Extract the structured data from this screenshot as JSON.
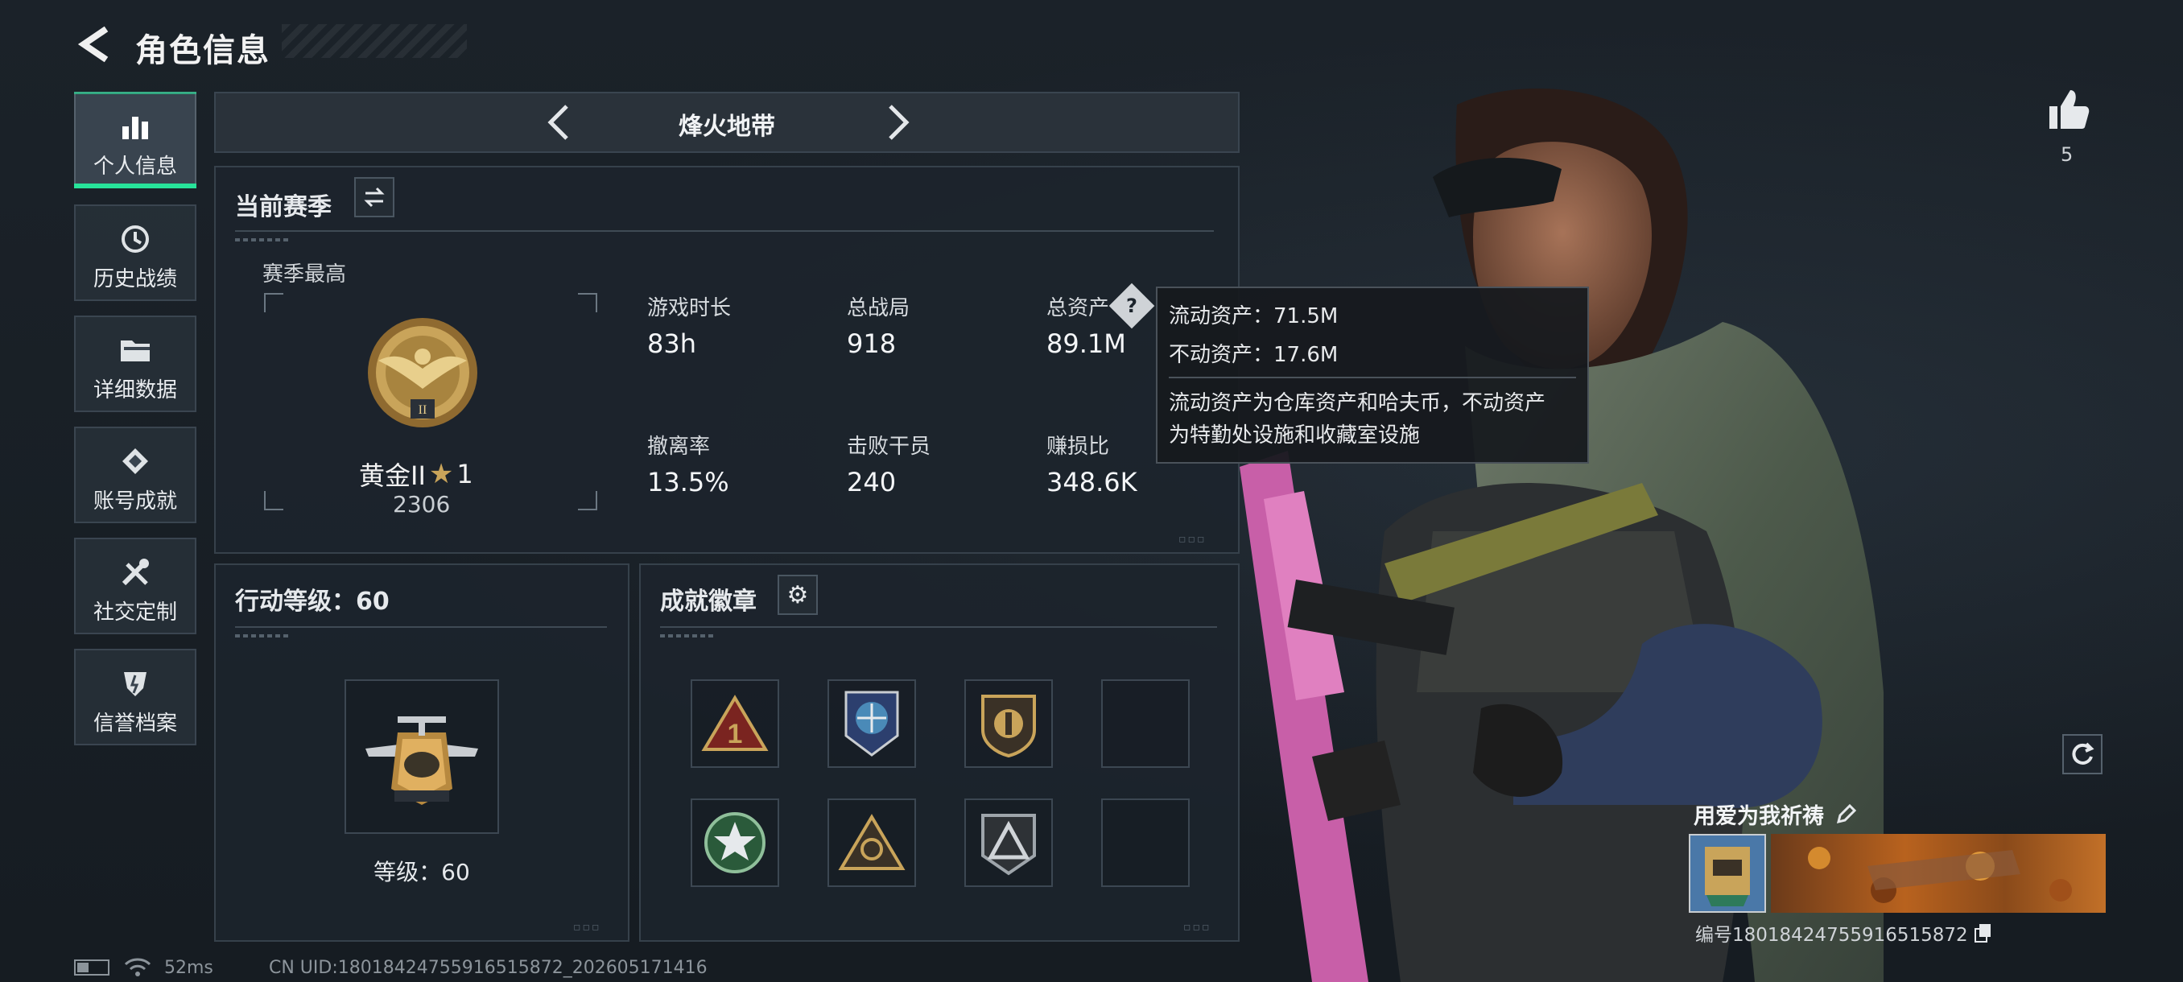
{
  "header": {
    "title": "角色信息"
  },
  "sidebar": {
    "items": [
      {
        "label": "个人信息",
        "icon": "bar-chart-icon",
        "active": true
      },
      {
        "label": "历史战绩",
        "icon": "history-icon",
        "active": false
      },
      {
        "label": "详细数据",
        "icon": "folder-icon",
        "active": false
      },
      {
        "label": "账号成就",
        "icon": "achievement-icon",
        "active": false
      },
      {
        "label": "社交定制",
        "icon": "tools-icon",
        "active": false
      },
      {
        "label": "信誉档案",
        "icon": "shield-icon",
        "active": false
      }
    ]
  },
  "mode_selector": {
    "label": "烽火地带"
  },
  "season": {
    "title": "当前赛季",
    "best_label": "赛季最高",
    "rank_name": "黄金II",
    "rank_stars": "1",
    "rank_score": "2306",
    "stats": [
      {
        "label": "游戏时长",
        "value": "83h"
      },
      {
        "label": "总战局",
        "value": "918"
      },
      {
        "label": "总资产",
        "value": "89.1M"
      },
      {
        "label": "撤离率",
        "value": "13.5%"
      },
      {
        "label": "击败干员",
        "value": "240"
      },
      {
        "label": "赚损比",
        "value": "348.6K"
      }
    ]
  },
  "tooltip": {
    "line1": "流动资产：71.5M",
    "line2": "不动资产：17.6M",
    "desc1": "流动资产为仓库资产和哈夫币，不动资产",
    "desc2": "为特勤处设施和收藏室设施"
  },
  "action_level": {
    "title": "行动等级：60",
    "level_text": "等级：60"
  },
  "badges": {
    "title": "成就徽章",
    "slots": [
      "triangle-one-badge",
      "globe-badge",
      "shield-badge",
      "empty",
      "wreath-star-badge",
      "gold-triangle-badge",
      "silver-triangle-badge",
      "empty"
    ]
  },
  "likes": {
    "count": "5"
  },
  "player": {
    "name": "用爱为我祈祷",
    "id_text": "编号18018424755916515872"
  },
  "footer": {
    "ping": "52ms",
    "uid": "CN UID:18018424755916515872_202605171416"
  },
  "colors": {
    "accent": "#27e39a",
    "panel": "#1c242c",
    "gold": "#c9a45a"
  }
}
